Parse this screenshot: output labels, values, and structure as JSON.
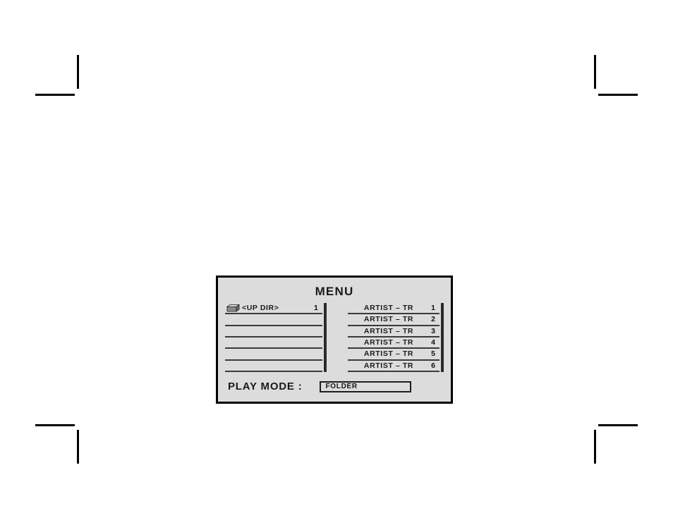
{
  "page": {
    "background_color": "#ffffff",
    "crop_marks": [
      {
        "name": "top-left"
      },
      {
        "name": "top-right"
      },
      {
        "name": "bottom-left"
      },
      {
        "name": "bottom-right"
      }
    ]
  },
  "osd": {
    "title": "MENU",
    "panel_background": "#dcdcdc",
    "border_color": "#000000",
    "folder_list": {
      "rows": [
        {
          "icon": "folder-icon",
          "label": "<UP DIR>",
          "number": "1"
        },
        {
          "icon": null,
          "label": "",
          "number": ""
        },
        {
          "icon": null,
          "label": "",
          "number": ""
        },
        {
          "icon": null,
          "label": "",
          "number": ""
        },
        {
          "icon": null,
          "label": "",
          "number": ""
        },
        {
          "icon": null,
          "label": "",
          "number": ""
        }
      ]
    },
    "track_list": {
      "rows": [
        {
          "label": "ARTIST  –  TR",
          "number": "1"
        },
        {
          "label": "ARTIST  –  TR",
          "number": "2"
        },
        {
          "label": "ARTIST  –  TR",
          "number": "3"
        },
        {
          "label": "ARTIST  –  TR",
          "number": "4"
        },
        {
          "label": "ARTIST  –  TR",
          "number": "5"
        },
        {
          "label": "ARTIST  –  TR",
          "number": "6"
        }
      ]
    },
    "play_mode": {
      "label": "PLAY MODE :",
      "value": "FOLDER"
    }
  }
}
